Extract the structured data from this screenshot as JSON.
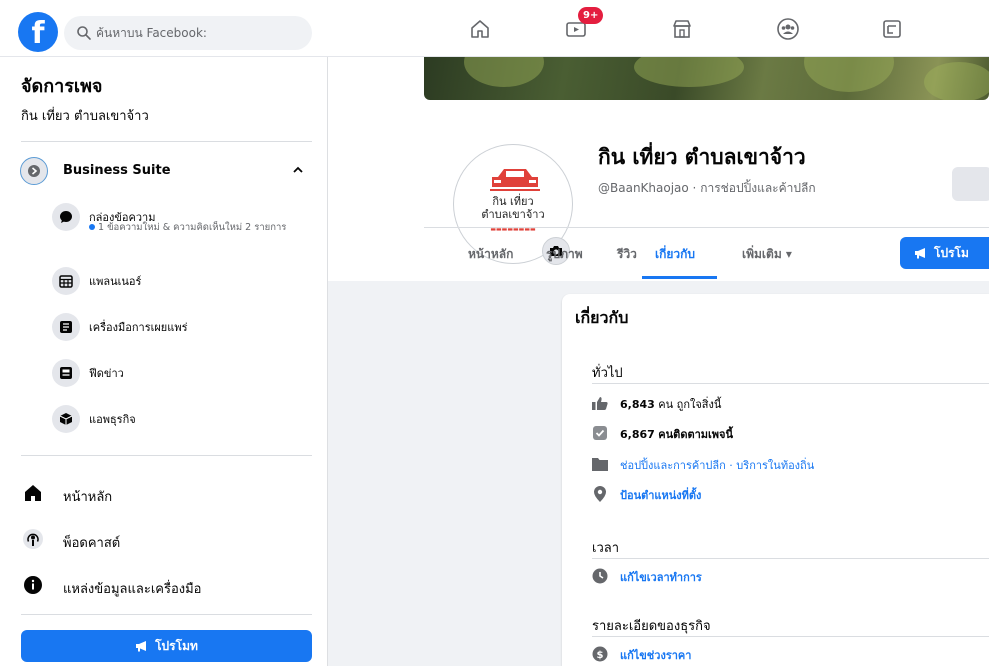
{
  "topbar": {
    "logo": "f",
    "search_placeholder": "ค้นหาบน Facebook:",
    "nav": [
      {
        "icon": "home-icon"
      },
      {
        "icon": "video-icon",
        "badge": "9+"
      },
      {
        "icon": "marketplace-icon"
      },
      {
        "icon": "groups-icon"
      },
      {
        "icon": "gaming-icon"
      }
    ]
  },
  "sidebar": {
    "title": "จัดการเพจ",
    "page_name": "กิน เที่ยว ตำบลเขาจ้าว",
    "business_suite": "Business Suite",
    "sub_items": [
      {
        "label": "กล่องข้อความ",
        "meta": "1 ข้อความใหม่ & ความคิดเห็นใหม่ 2 รายการ",
        "icon": "chat-bubble-icon"
      },
      {
        "label": "แพลนเนอร์",
        "icon": "calendar-icon"
      },
      {
        "label": "เครื่องมือการเผยแพร่",
        "icon": "publishing-tools-icon"
      },
      {
        "label": "ฟีดข่าว",
        "icon": "news-feed-icon"
      },
      {
        "label": "แอพธุรกิจ",
        "icon": "business-apps-icon"
      }
    ],
    "main_items": [
      {
        "label": "หน้าหลัก",
        "icon": "home-icon"
      },
      {
        "label": "พ็อดคาสต์",
        "icon": "podcast-icon"
      },
      {
        "label": "แหล่งข้อมูลและเครื่องมือ",
        "icon": "info-icon"
      }
    ],
    "promote": "โปรโมท"
  },
  "header": {
    "avatar_text1": "กิน เที่ยว",
    "avatar_text2": "ตำบลเขาจ้าว",
    "page_name": "กิน เที่ยว ตำบลเขาจ้าว",
    "handle_line": "@BaanKhaojao · การช่อปปิ้งและค้าปลีก",
    "tabs": [
      "หน้าหลัก",
      "รูปภาพ",
      "รีวิว",
      "เกี่ยวกับ",
      "เพิ่มเติม ▾"
    ],
    "promote": "โปรโม"
  },
  "about": {
    "title": "เกี่ยวกับ",
    "general": "ทั่วไป",
    "likes_num": "6,843",
    "likes_text": "คน ถูกใจสิ่งนี้",
    "follows_num": "6,867",
    "follows_text": "คนติดตามเพจนี้",
    "category": "ช่อปปิ้งและการค้าปลีก · บริการในท้องถิ่น",
    "location": "ป้อนตำแหน่งที่ตั้ง",
    "hours_title": "เวลา",
    "hours_link": "แก้ไขเวลาทำการ",
    "biz_title": "รายละเอียดของธุรกิจ",
    "price_link": "แก้ไขช่วงราคา"
  },
  "colors": {
    "brand": "#1877f2",
    "badge": "#e41e3f"
  }
}
